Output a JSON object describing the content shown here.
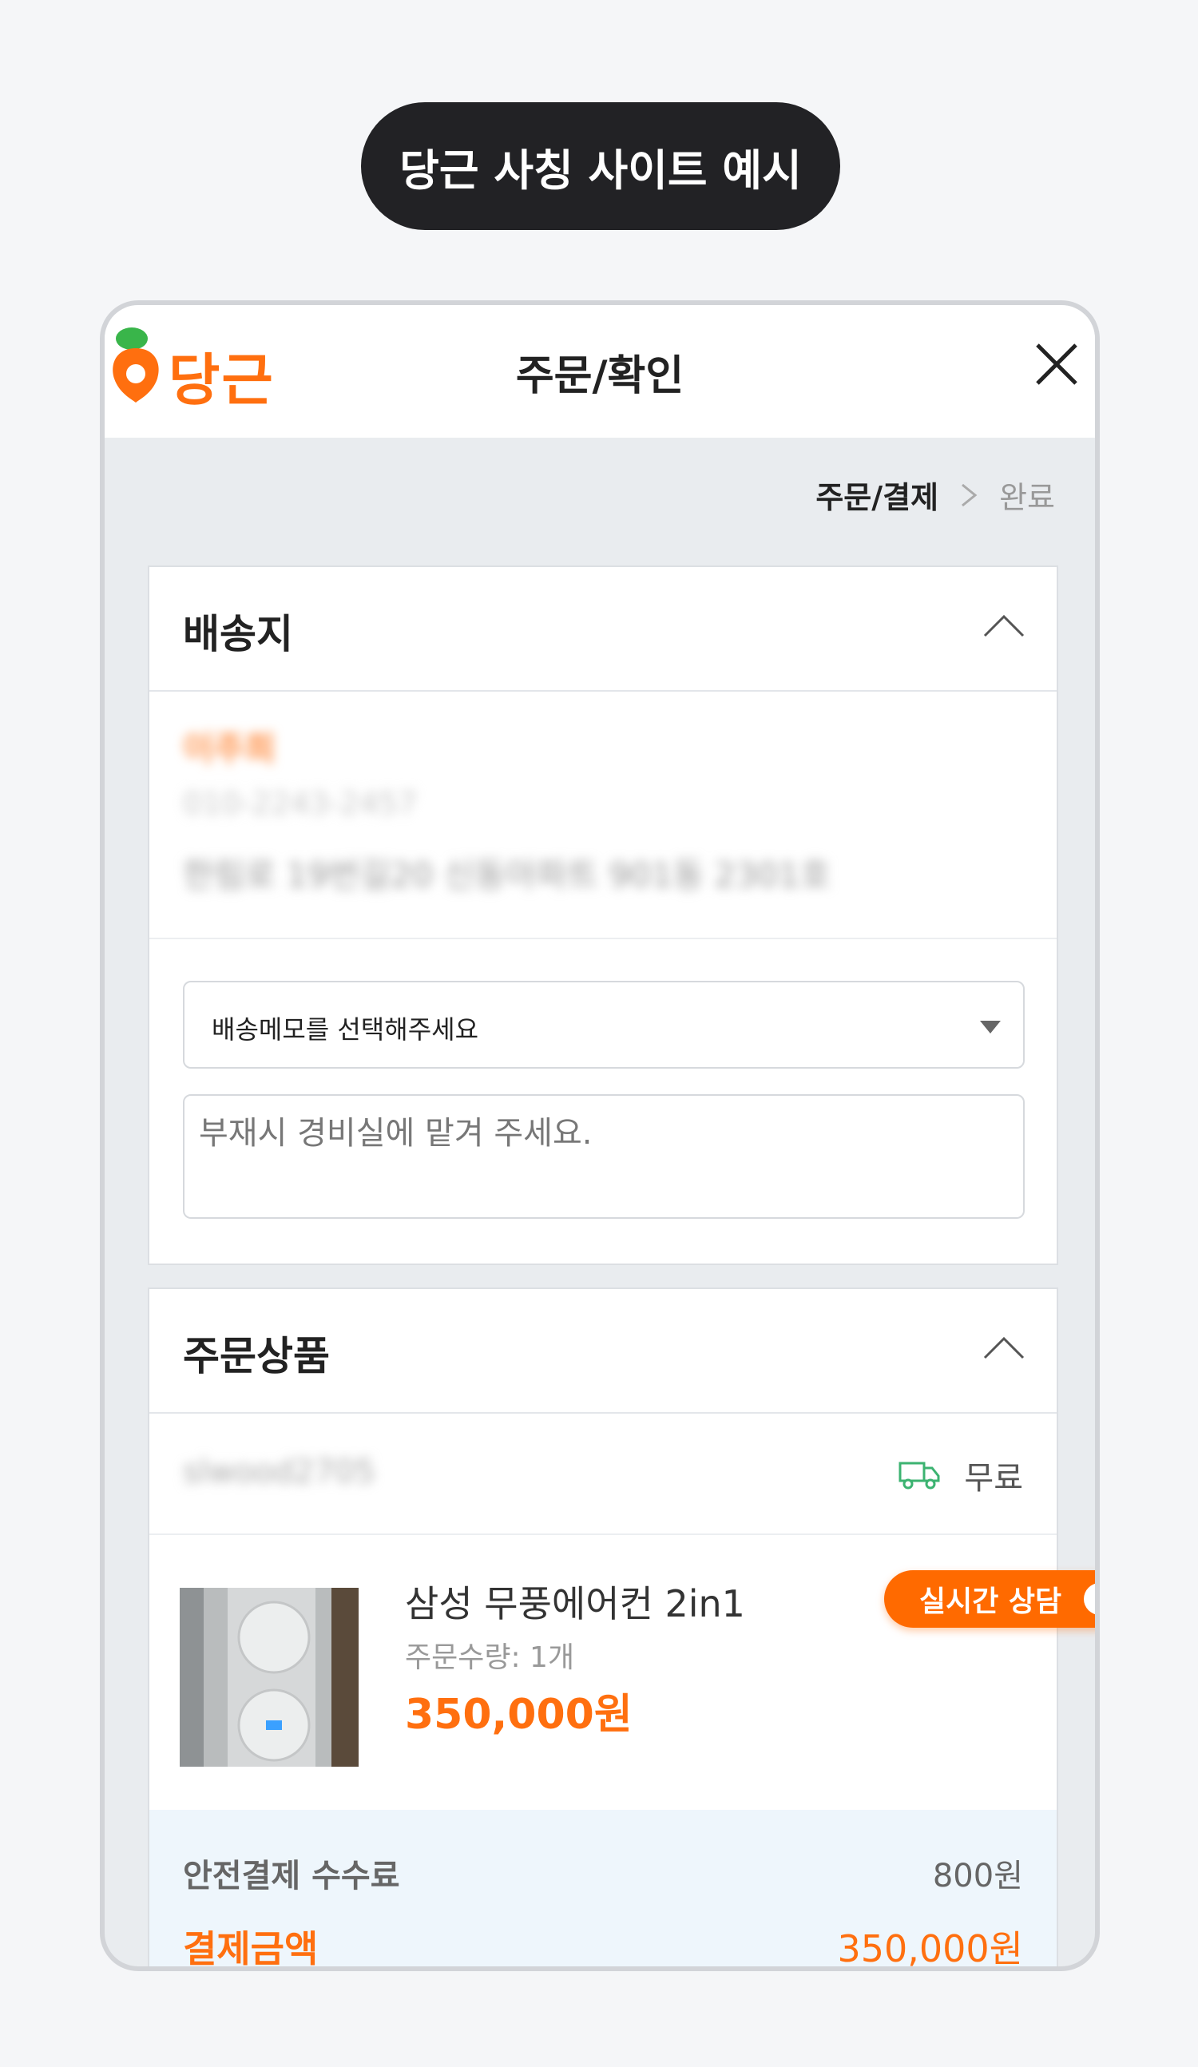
{
  "banner": {
    "label": "당근 사칭 사이트 예시"
  },
  "header": {
    "logo_text": "당근",
    "title": "주문/확인"
  },
  "steps": {
    "current": "주문/결제",
    "next": "완료"
  },
  "shipping": {
    "title": "배송지",
    "recipient_name": "이주희",
    "phone": "010-2243-2457",
    "address": "한림로 19번길20 신동아파트 901동 2301호",
    "memo_select": "배송메모를 선택해주세요",
    "memo_text": "부재시 경비실에 맡겨 주세요."
  },
  "live_chat": {
    "label": "실시간 상담"
  },
  "order": {
    "title": "주문상품",
    "seller": "slwood2705",
    "shipping_fee": "무료",
    "product_name": "삼성 무풍에어컨 2in1",
    "quantity": "주문수량: 1개",
    "price": "350,000원"
  },
  "summary": {
    "fee_label": "안전결제 수수료",
    "fee_value": "800원",
    "total_label": "결제금액",
    "total_value": "350,000원"
  },
  "colors": {
    "brand": "#ff6f0f",
    "banner_bg": "#222225",
    "shipping_icon": "#3cb371"
  },
  "icons": [
    "carrot-logo-icon",
    "close-icon",
    "chevron-right-icon",
    "chevron-up-icon",
    "caret-down-icon",
    "play-icon",
    "truck-icon"
  ]
}
